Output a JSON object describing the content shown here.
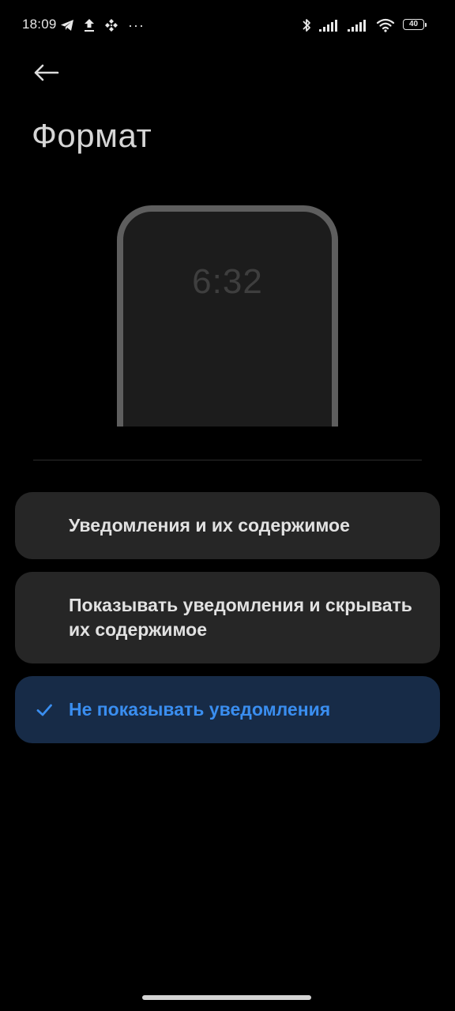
{
  "status_bar": {
    "time": "18:09",
    "more": "···",
    "battery_level": "40",
    "left_icons": [
      "telegram-icon",
      "upload-icon",
      "binance-icon"
    ],
    "right_icons": [
      "bluetooth-icon",
      "signal-icon",
      "signal-icon",
      "wifi-icon",
      "battery-icon"
    ]
  },
  "header": {
    "back_icon": "arrow-left-icon",
    "title": "Формат"
  },
  "preview": {
    "clock": "6:32"
  },
  "options": [
    {
      "label": "Уведомления и их содержимое",
      "selected": false
    },
    {
      "label": "Показывать уведомления и скрывать их содержимое",
      "selected": false
    },
    {
      "label": "Не показывать уведомления",
      "selected": true
    }
  ],
  "colors": {
    "background": "#000000",
    "option_bg": "#262626",
    "selected_bg": "#172b47",
    "accent": "#3a8ef0"
  }
}
